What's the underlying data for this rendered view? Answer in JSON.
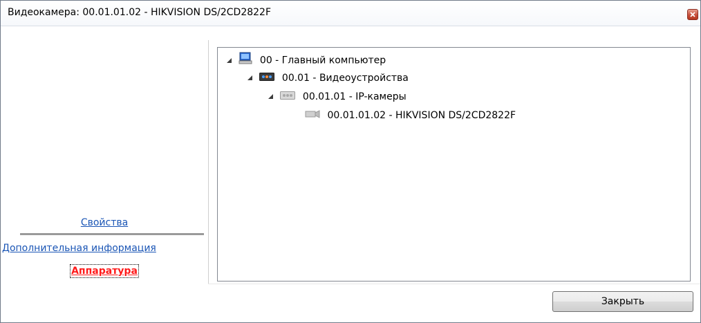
{
  "window": {
    "title": "Видеокамера: 00.01.01.02 - HIKVISION DS/2CD2822F"
  },
  "nav": {
    "properties": "Свойства",
    "extra_info": "Дополнительная информация",
    "hardware": "Аппаратура",
    "link_color": "#1a55b5",
    "active_color": "#ff1a1a"
  },
  "tree": [
    {
      "label": "00 - Главный компьютер",
      "icon": "computer-icon",
      "expanded": true
    },
    {
      "label": "00.01 - Видеоустройства",
      "icon": "video-devices-icon",
      "expanded": true
    },
    {
      "label": "00.01.01 - IP-камеры",
      "icon": "ip-cameras-icon",
      "expanded": true
    },
    {
      "label": "00.01.01.02 - HIKVISION DS/2CD2822F",
      "icon": "camera-icon",
      "expanded": false
    }
  ],
  "footer": {
    "close_label": "Закрыть"
  }
}
